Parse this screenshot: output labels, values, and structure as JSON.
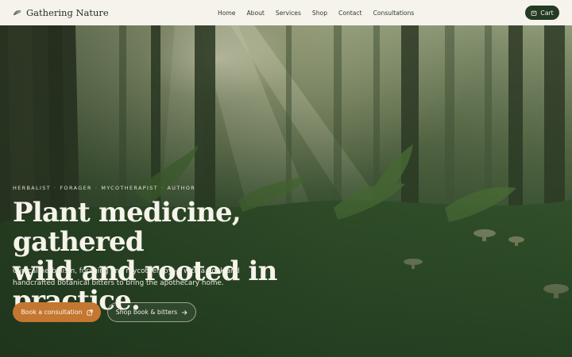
{
  "header": {
    "brand_name": "Gathering Nature",
    "nav": [
      {
        "label": "Home"
      },
      {
        "label": "About"
      },
      {
        "label": "Services"
      },
      {
        "label": "Shop"
      },
      {
        "label": "Contact"
      },
      {
        "label": "Consultations"
      }
    ],
    "cart_label": "Cart"
  },
  "hero": {
    "eyebrow": [
      "HERBALIST",
      "FORAGER",
      "MYCOTHERAPIST",
      "AUTHOR"
    ],
    "eyebrow_separator": "·",
    "headline_line1": "Plant medicine, gathered",
    "headline_line2": "wild and rooted in practice.",
    "subtitle": "Clinical herbalism, foraging and mycotherapy — with a book and handcrafted botanical bitters to bring the apothecary home.",
    "primary_button": "Book a consultation",
    "secondary_button": "Shop book & bitters"
  },
  "colors": {
    "header_bg": "#f6f3ec",
    "cart_bg": "#233a23",
    "primary_accent": "#c47730",
    "forest_dark": "#2f4a2c"
  },
  "icons": {
    "brand": "leaf-logo-icon",
    "cart": "bag-icon",
    "primary_button": "external-link-icon",
    "secondary_button": "arrow-right-icon"
  }
}
